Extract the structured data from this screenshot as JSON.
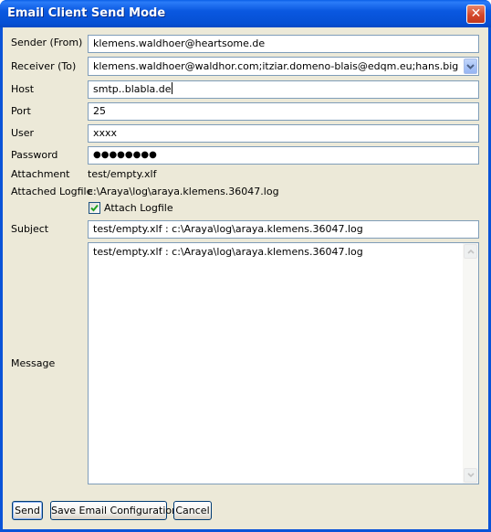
{
  "window": {
    "title": "Email Client Send Mode",
    "close_glyph": "✕"
  },
  "form": {
    "sender_label": "Sender (From)",
    "sender_value": "klemens.waldhoer@heartsome.de",
    "receiver_label": "Receiver (To)",
    "receiver_value": "klemens.waldhoer@waldhor.com;itziar.domeno-blais@edqm.eu;hans.bigalke@edqm",
    "host_label": "Host",
    "host_value": "smtp..blabla.de",
    "port_label": "Port",
    "port_value": "25",
    "user_label": "User",
    "user_value": "xxxx",
    "password_label": "Password",
    "password_value": "●●●●●●●●",
    "attachment_label": "Attachment",
    "attachment_value": "test/empty.xlf",
    "logfile_label": "Attached Logfile",
    "logfile_value": "c:\\Araya\\log\\araya.klemens.36047.log",
    "attach_logfile_label": "Attach Logfile",
    "attach_logfile_checked": true,
    "subject_label": "Subject",
    "subject_value": "test/empty.xlf : c:\\Araya\\log\\araya.klemens.36047.log",
    "message_label": "Message",
    "message_value": "test/empty.xlf : c:\\Araya\\log\\araya.klemens.36047.log"
  },
  "buttons": {
    "send": "Send",
    "save_config": "Save Email Configuration",
    "cancel": "Cancel"
  },
  "icons": {
    "close": "close-icon",
    "dropdown": "chevron-down-icon",
    "check": "check-icon",
    "scroll_up": "scroll-up-icon",
    "scroll_down": "scroll-down-icon"
  },
  "colors": {
    "titlebar": "#0a58e0",
    "dialog_bg": "#ece9d8",
    "field_border": "#7f9db9",
    "close_button": "#d4472a"
  }
}
